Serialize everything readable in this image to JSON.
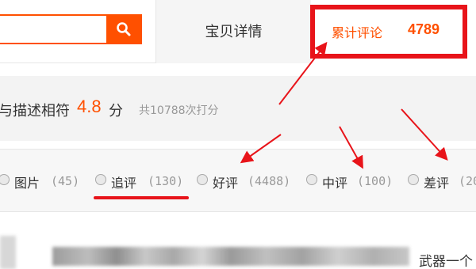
{
  "search": {
    "value": "",
    "button_icon": "search-icon"
  },
  "tabs": {
    "detail_label": "宝贝详情",
    "reviews_label": "累计评论",
    "reviews_count": "4789"
  },
  "rating": {
    "description": "与描述相符",
    "score": "4.8",
    "unit": "分",
    "count_text": "共10788次打分"
  },
  "filters": [
    {
      "label": "图片",
      "count": "(45)"
    },
    {
      "label": "追评",
      "count": "(130)"
    },
    {
      "label": "好评",
      "count": "(4488)"
    },
    {
      "label": "中评",
      "count": "(100)"
    },
    {
      "label": "差评",
      "count": "(20"
    }
  ],
  "review": {
    "snippet": "武器一个"
  },
  "colors": {
    "accent": "#ff5000",
    "annotation": "#e8141a"
  }
}
